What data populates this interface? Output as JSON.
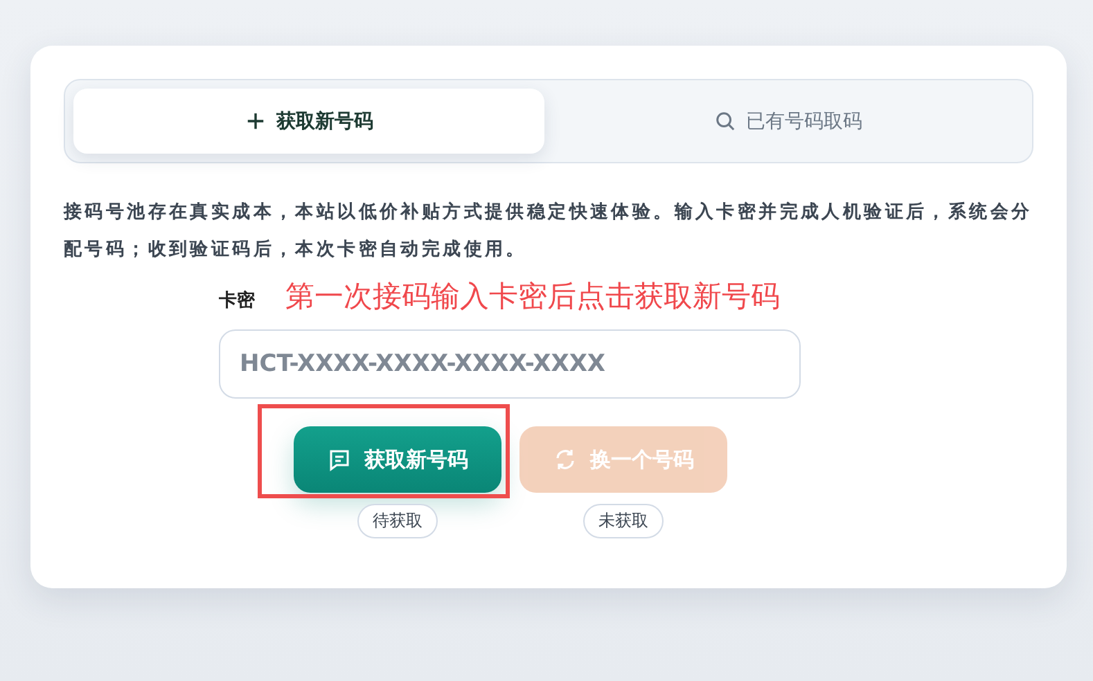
{
  "tabs": [
    {
      "label": "获取新号码",
      "selected": true
    },
    {
      "label": "已有号码取码",
      "selected": false
    }
  ],
  "description": "接码号池存在真实成本，本站以低价补贴方式提供稳定快速体验。输入卡密并完成人机验证后，系统会分配号码；收到验证码后，本次卡密自动完成使用。",
  "card_key": {
    "label": "卡密",
    "placeholder": "HCT-XXXX-XXXX-XXXX-XXXX"
  },
  "annotation": {
    "text": "第一次接码输入卡密后点击获取新号码"
  },
  "actions": [
    {
      "label": "获取新号码",
      "kind": "primary",
      "disabled": false,
      "highlighted": true,
      "status": "待获取"
    },
    {
      "label": "换一个号码",
      "kind": "secondary",
      "disabled": true,
      "highlighted": false,
      "status": "未获取"
    }
  ]
}
